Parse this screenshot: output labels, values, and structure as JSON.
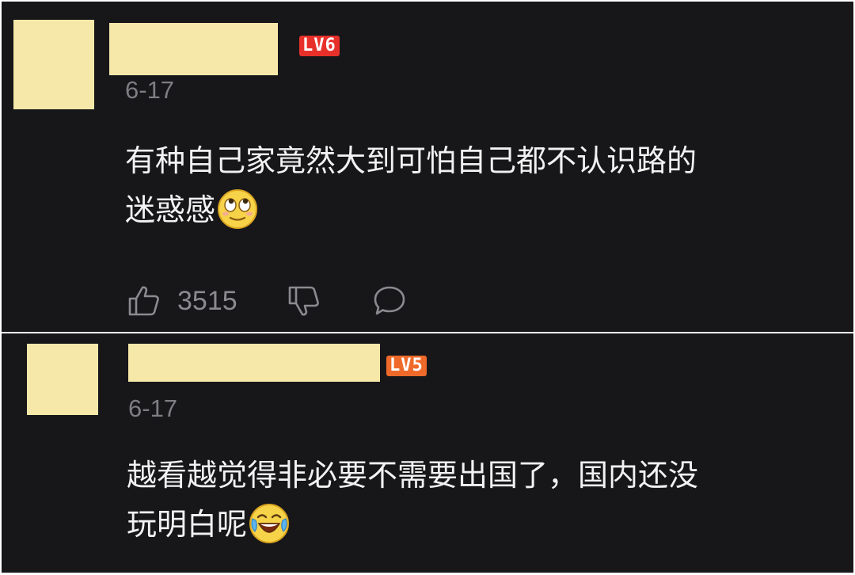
{
  "comments": [
    {
      "level": "LV6",
      "date": "6-17",
      "text_line1": "有种自己家竟然大到可怕自己都不认识路的",
      "text_line2": "迷惑感",
      "emoji": "rolling-eyes-emoji",
      "likes": "3515",
      "level_color": "#e8302a"
    },
    {
      "level": "LV5",
      "date": "6-17",
      "text_line1": "越看越觉得非必要不需要出国了，国内还没",
      "text_line2": "玩明白呢",
      "emoji": "laughing-crying-emoji",
      "level_color": "#ef6a2a"
    }
  ],
  "icons": {
    "like": "thumbs-up-icon",
    "dislike": "thumbs-down-icon",
    "reply": "comment-bubble-icon"
  },
  "colors": {
    "background": "#17171a",
    "redaction": "#f6e8a8",
    "text": "#f2f2f2",
    "muted": "#7d7d82"
  }
}
